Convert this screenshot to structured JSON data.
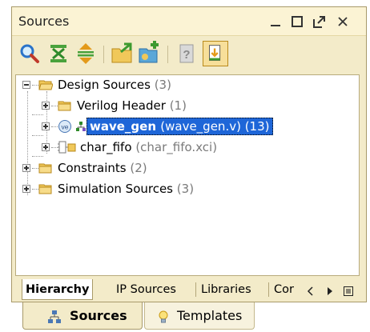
{
  "panel": {
    "title": "Sources",
    "controls": [
      "minimize-icon",
      "maximize-icon",
      "float-icon",
      "close-icon"
    ]
  },
  "toolbar": {
    "buttons": [
      "search-icon",
      "collapse-all-icon",
      "expand-all-icon",
      "add-sources-icon",
      "new-source-icon",
      "properties-icon",
      "show-hierarchy-icon"
    ]
  },
  "tree": {
    "design_sources": {
      "label": "Design Sources",
      "count": "(3)"
    },
    "verilog_header": {
      "label": "Verilog Header",
      "count": "(1)"
    },
    "wave_gen": {
      "label": "wave_gen",
      "detail": "(wave_gen.v) (13)"
    },
    "char_fifo": {
      "label": "char_fifo",
      "detail": "(char_fifo.xci)"
    },
    "constraints": {
      "label": "Constraints",
      "count": "(2)"
    },
    "simulation_sources": {
      "label": "Simulation Sources",
      "count": "(3)"
    }
  },
  "view_tabs": {
    "hierarchy": "Hierarchy",
    "ip_sources": "IP Sources",
    "libraries": "Libraries",
    "compile_order": "Cor"
  },
  "bottom_tabs": {
    "sources": "Sources",
    "templates": "Templates"
  },
  "colors": {
    "panel_bg": "#f3ebc9",
    "selection": "#1e66d8",
    "folder": "#f0c85a"
  }
}
